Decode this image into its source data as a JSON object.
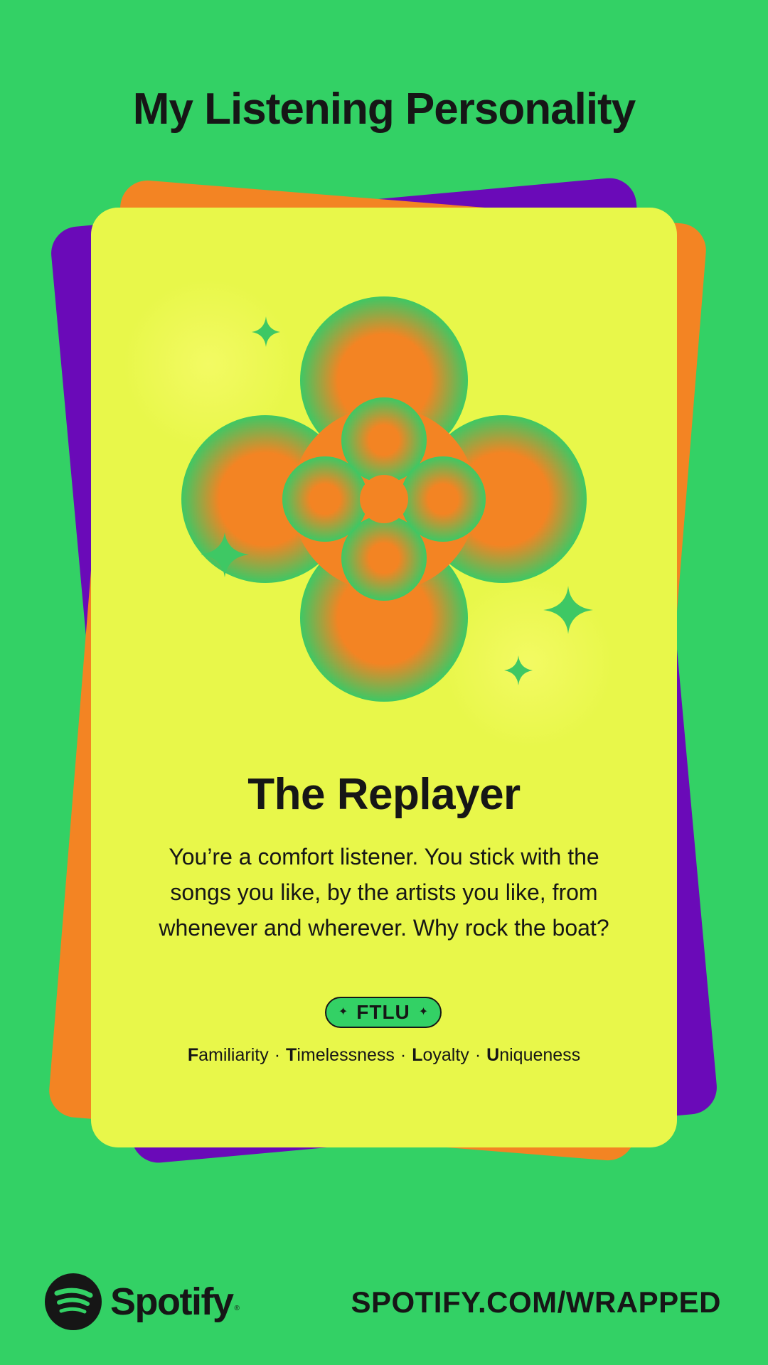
{
  "header": {
    "title": "My Listening Personality"
  },
  "card": {
    "persona_name": "The Replayer",
    "description": "You’re a comfort listener. You stick with the songs you like, by the artists you like, from whenever and wherever. Why rock the boat?",
    "code": "FTLU",
    "traits": [
      {
        "initial": "F",
        "rest": "amiliarity"
      },
      {
        "initial": "T",
        "rest": "imelessness"
      },
      {
        "initial": "L",
        "rest": "oyalty"
      },
      {
        "initial": "U",
        "rest": "niqueness"
      }
    ],
    "trait_separator": "·"
  },
  "footer": {
    "brand": "Spotify",
    "registered_mark": "®",
    "url": "SPOTIFY.COM/WRAPPED"
  },
  "colors": {
    "background": "#33d165",
    "card_front": "#e8f74a",
    "card_orange": "#f38423",
    "card_purple": "#6a0ab8",
    "text": "#161616"
  },
  "icons": [
    "spotify-logo-icon",
    "sparkle-icon",
    "flower-artwork"
  ]
}
